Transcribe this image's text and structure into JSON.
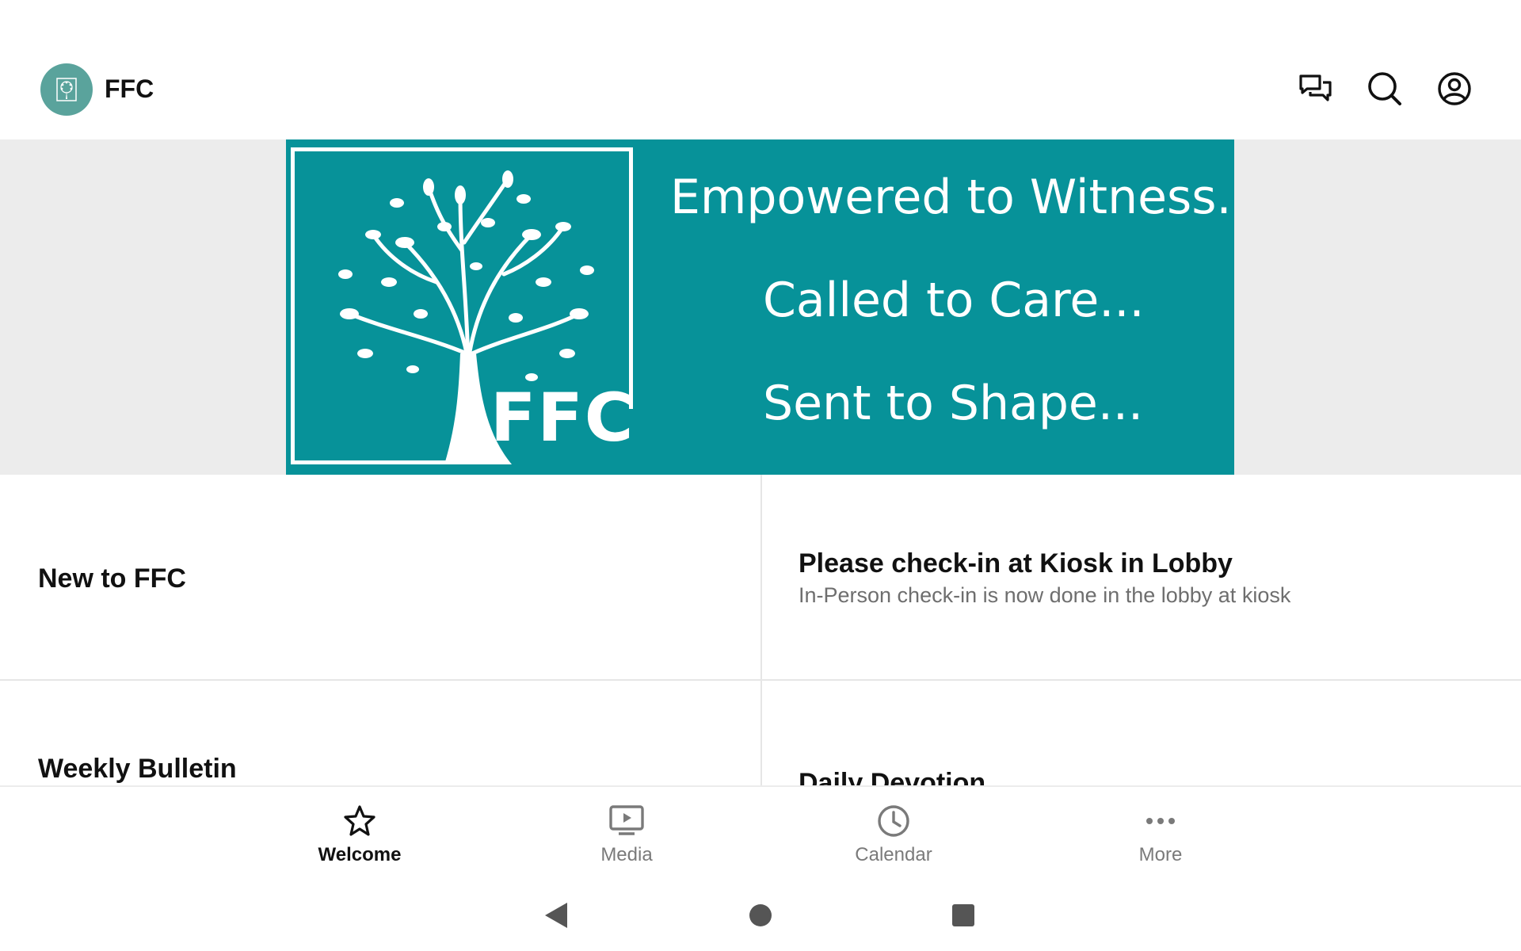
{
  "header": {
    "app_title": "FFC",
    "logo_icon": "church-tree-logo",
    "actions": [
      "chat-icon",
      "search-icon",
      "account-icon"
    ]
  },
  "banner": {
    "logo_text": "FFC",
    "taglines": [
      "Empowered to Witness...",
      "Called to Care...",
      "Sent to Shape..."
    ],
    "background_color": "#079299"
  },
  "cards": [
    {
      "title": "New to FFC",
      "subtitle": ""
    },
    {
      "title": "Please check-in at Kiosk in Lobby",
      "subtitle": "In-Person check-in is now done in the lobby at kiosk"
    },
    {
      "title": "Weekly Bulletin",
      "subtitle": ""
    },
    {
      "title": "Daily Devotion",
      "subtitle": ""
    }
  ],
  "tabs": [
    {
      "label": "Welcome",
      "icon": "star-icon",
      "active": true
    },
    {
      "label": "Media",
      "icon": "tv-play-icon",
      "active": false
    },
    {
      "label": "Calendar",
      "icon": "clock-icon",
      "active": false
    },
    {
      "label": "More",
      "icon": "more-dots-icon",
      "active": false
    }
  ],
  "system_nav": [
    "back-icon",
    "home-icon",
    "recents-icon"
  ],
  "colors": {
    "accent": "#079299",
    "logo_circle": "#5aa39c",
    "text": "#111111",
    "muted": "#6e6e6e"
  }
}
